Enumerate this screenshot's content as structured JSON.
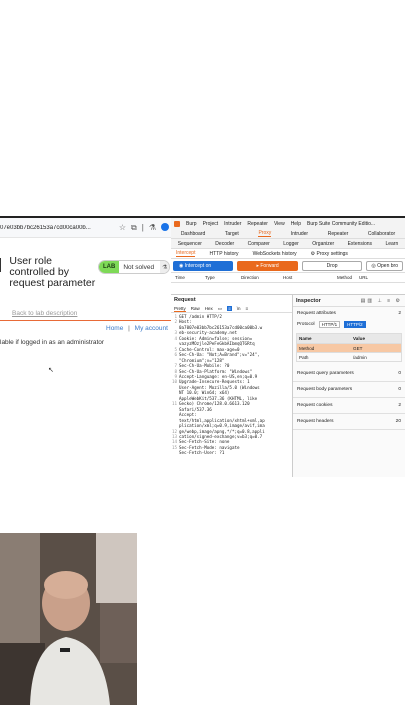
{
  "browser": {
    "url": "07e03bb7bc26153a7cd00ca00b...",
    "lab_title": "User role controlled by request parameter",
    "lab_badge": "LAB",
    "lab_status": "Not solved",
    "back_link": "Back to lab description",
    "nav_home": "Home",
    "nav_sep": "|",
    "nav_account": "My account",
    "admin_message": "lable if logged in as an administrator"
  },
  "burp": {
    "menu": [
      "Burp",
      "Project",
      "Intruder",
      "Repeater",
      "View",
      "Help"
    ],
    "app_title": "Burp Suite Community Editio...",
    "tabs_row1": [
      "Dashboard",
      "Target",
      "Proxy",
      "Intruder",
      "Repeater",
      "Collaborator"
    ],
    "tabs_row2": [
      "Sequencer",
      "Decoder",
      "Comparer",
      "Logger",
      "Organizer",
      "Extensions",
      "Learn"
    ],
    "subtabs": [
      "Intercept",
      "HTTP history",
      "WebSockets history",
      "Proxy settings"
    ],
    "intercept_btn": "Intercept on",
    "forward_btn": "Forward",
    "drop_btn": "Drop",
    "open_browser_btn": "Open bro",
    "columns": [
      "Time",
      "Type",
      "Direction",
      "Host",
      "Method",
      "URL"
    ],
    "request_title": "Request",
    "request_tabs": [
      "Pretty",
      "Raw",
      "Hex"
    ],
    "request_line_numbers": [
      "1",
      "2",
      "",
      "3",
      "4",
      "",
      "5",
      "6",
      "",
      "7",
      "8",
      "9",
      "10",
      "",
      "",
      "",
      "11",
      "",
      "",
      "",
      "",
      "12",
      "13",
      "14",
      "15"
    ],
    "request_lines": [
      "GET /admin HTTP/2",
      "Host:",
      "0a7007e03bb7bc26153a7cd00ca00b3.w",
      "eb-security-academy.net",
      "Cookie: Admin=false; session=",
      "vazyzMOzjle2PeFeGkbAIbmqQTGRtq",
      "Cache-Control: max-age=0",
      "Sec-Ch-Ua: \"Not;A=Brand\";v=\"24\",",
      "\"Chromium\";v=\"128\"",
      "Sec-Ch-Ua-Mobile: ?0",
      "Sec-Ch-Ua-Platform: \"Windows\"",
      "Accept-Language: en-US,en;q=0.9",
      "Upgrade-Insecure-Requests: 1",
      "User-Agent: Mozilla/5.0 (Windows",
      "NT 10.0; Win64; x64)",
      "AppleWebKit/537.36 (KHTML, like",
      "Gecko) Chrome/128.0.6613.120",
      "Safari/537.36",
      "Accept:",
      "text/html,application/xhtml+xml,ap",
      "plication/xml;q=0.9,image/avif,ima",
      "ge/webp,image/apng,*/*;q=0.8,appli",
      "cation/signed-exchange;v=b3;q=0.7",
      "Sec-Fetch-Site: none",
      "Sec-Fetch-Mode: navigate",
      "Sec-Fetch-User: ?1"
    ],
    "inspector_title": "Inspector",
    "request_attributes": "Request attributes",
    "request_attributes_count": "2",
    "protocol_label": "Protocol",
    "protocol_options": [
      "HTTP/1",
      "HTTP/2"
    ],
    "attr_headers": [
      "Name",
      "Value"
    ],
    "attr_rows": [
      {
        "name": "Method",
        "value": "GET"
      },
      {
        "name": "Path",
        "value": "/admin"
      }
    ],
    "sections": [
      {
        "label": "Request query parameters",
        "count": "0"
      },
      {
        "label": "Request body parameters",
        "count": "0"
      },
      {
        "label": "Request cookies",
        "count": "2"
      },
      {
        "label": "Request headers",
        "count": "20"
      }
    ]
  }
}
